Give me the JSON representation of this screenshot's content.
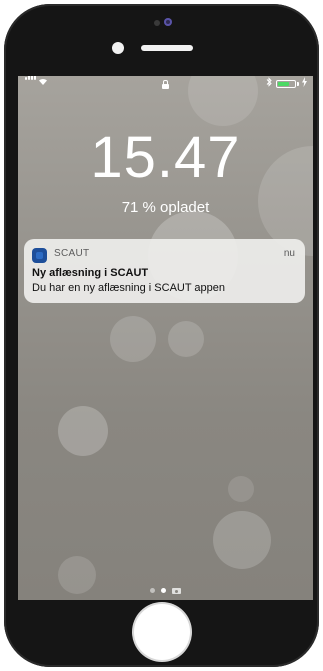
{
  "status_bar": {
    "bluetooth_icon": "bluetooth-icon",
    "battery_level": 0.71,
    "battery_color": "#4cd964"
  },
  "lockscreen": {
    "time": "15.47",
    "charge_status": "71 % opladet"
  },
  "notification": {
    "app_name": "SCAUT",
    "time": "nu",
    "title": "Ny aflæsning i SCAUT",
    "body": "Du har en ny aflæsning i SCAUT appen",
    "icon": "scaut-app-icon",
    "icon_color": "#1e4f9a"
  },
  "page_indicator": {
    "pages": 2,
    "active_index": 1,
    "trailing_icon": "camera-icon"
  }
}
